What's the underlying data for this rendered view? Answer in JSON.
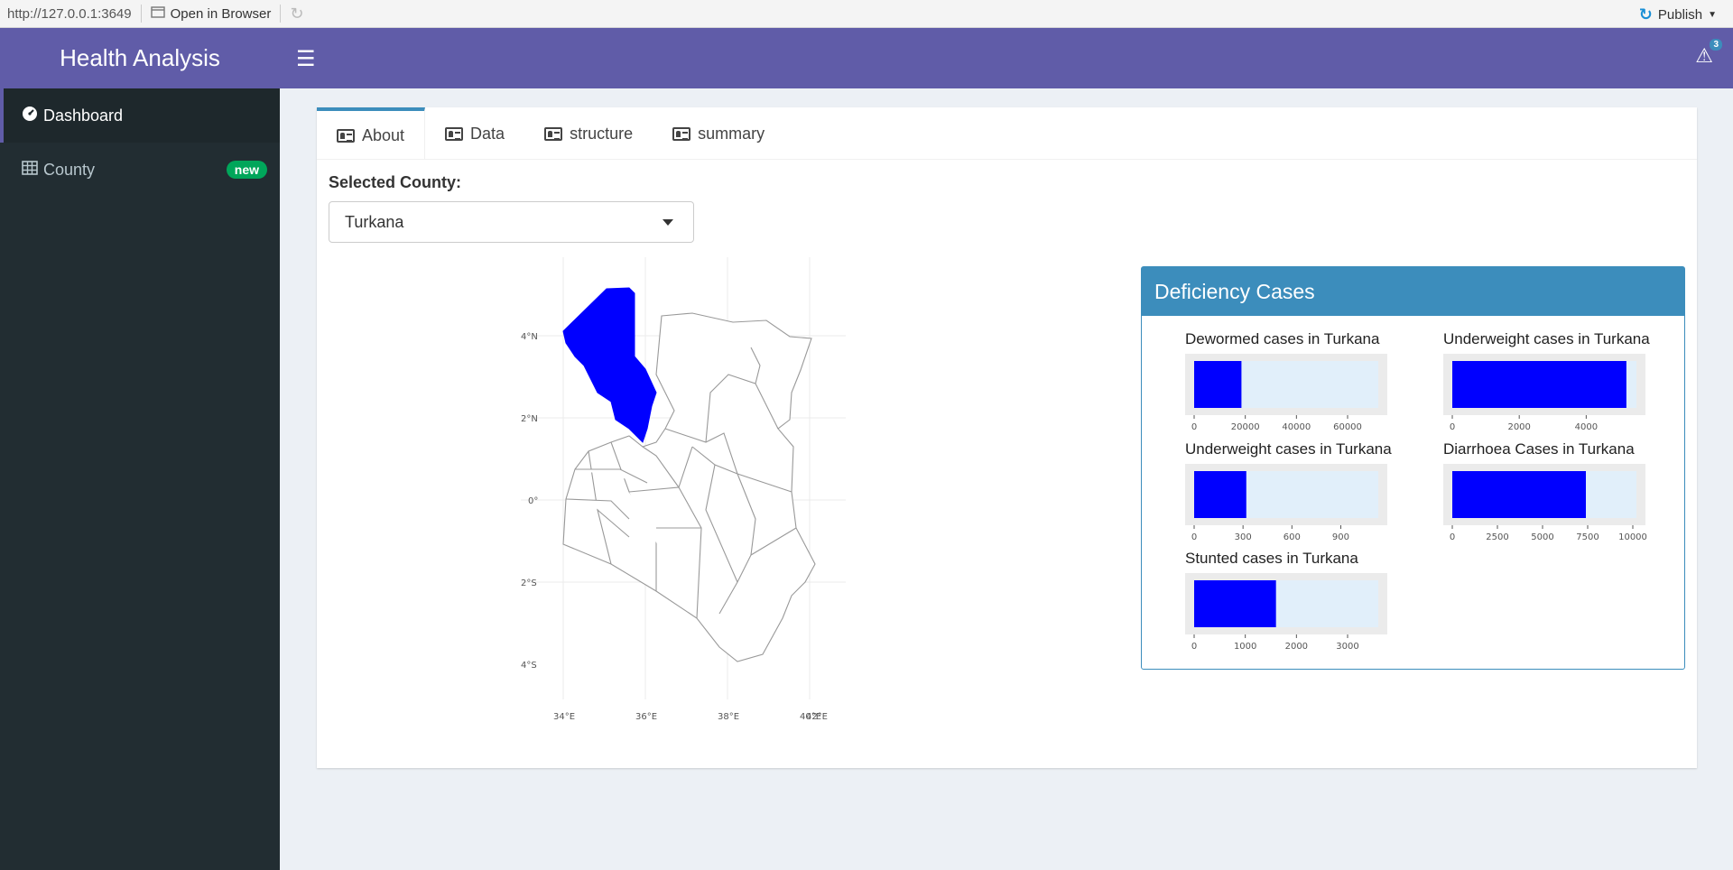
{
  "browser": {
    "url": "http://127.0.0.1:3649",
    "open_in_browser": "Open in Browser",
    "publish": "Publish"
  },
  "app": {
    "title": "Health Analysis"
  },
  "sidebar": {
    "items": [
      {
        "label": "Dashboard",
        "icon": "dashboard-icon",
        "active": true
      },
      {
        "label": "County",
        "icon": "table-icon",
        "badge": "new"
      }
    ]
  },
  "header": {
    "notification_count": "3"
  },
  "tabs": [
    {
      "label": "About",
      "active": true
    },
    {
      "label": "Data"
    },
    {
      "label": "structure"
    },
    {
      "label": "summary"
    }
  ],
  "county_select": {
    "label": "Selected County:",
    "value": "Turkana"
  },
  "map": {
    "highlight_color": "#0000ff",
    "x_ticks": [
      "34°E",
      "36°E",
      "38°E",
      "40°E",
      "42°E"
    ],
    "y_ticks": [
      "4°N",
      "2°N",
      "0°",
      "2°S",
      "4°S"
    ]
  },
  "deficiency": {
    "title": "Deficiency Cases"
  },
  "chart_data": [
    {
      "type": "bar",
      "title": "Dewormed cases in Turkana",
      "values": [
        18500
      ],
      "xlim": [
        0,
        72000
      ],
      "ticks": [
        0,
        20000,
        40000,
        60000
      ],
      "color": "#0000ff"
    },
    {
      "type": "bar",
      "title": "Underweight cases in Turkana",
      "values": [
        5200
      ],
      "xlim": [
        0,
        5500
      ],
      "ticks": [
        0,
        2000,
        4000
      ],
      "color": "#0000ff"
    },
    {
      "type": "bar",
      "title": "Underweight cases in Turkana",
      "values": [
        320
      ],
      "xlim": [
        0,
        1130
      ],
      "ticks": [
        0,
        300,
        600,
        900
      ],
      "color": "#0000ff"
    },
    {
      "type": "bar",
      "title": "Diarrhoea Cases in Turkana",
      "values": [
        7400
      ],
      "xlim": [
        0,
        10200
      ],
      "ticks": [
        0,
        2500,
        5000,
        7500,
        10000
      ],
      "color": "#0000ff"
    },
    {
      "type": "bar",
      "title": "Stunted cases in Turkana",
      "values": [
        1600
      ],
      "xlim": [
        0,
        3600
      ],
      "ticks": [
        0,
        1000,
        2000,
        3000
      ],
      "color": "#0000ff"
    }
  ]
}
